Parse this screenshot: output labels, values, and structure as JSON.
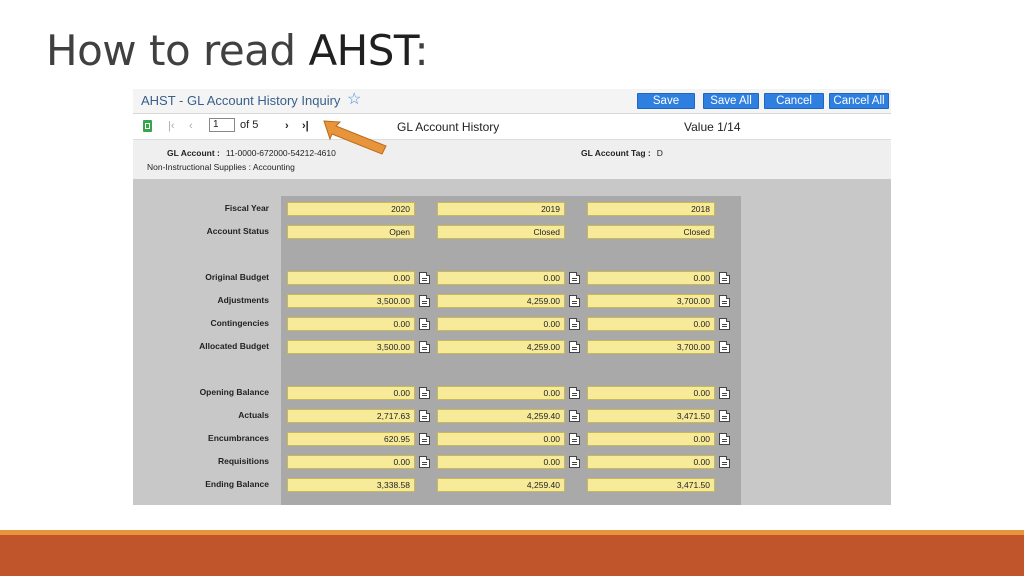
{
  "slide": {
    "title_prefix": "How to read ",
    "title_highlight": "AHST",
    "title_suffix": ":"
  },
  "app": {
    "title": "AHST - GL Account History Inquiry",
    "buttons": {
      "save": "Save",
      "save_all": "Save All",
      "cancel": "Cancel",
      "cancel_all": "Cancel All"
    }
  },
  "nav": {
    "first": "|‹",
    "prev": "‹",
    "page_value": "1",
    "of_label": "of 5",
    "next": "›",
    "last": "›|",
    "center_title": "GL Account History",
    "value_count": "Value 1/14"
  },
  "account": {
    "gl_account_label": "GL Account :",
    "gl_account_value": "11-0000-672000-54212-4610",
    "description": "Non-Instructional Supplies : Accounting",
    "tag_label": "GL Account Tag :",
    "tag_value": "D"
  },
  "history": {
    "rows": [
      {
        "label": "Fiscal Year",
        "values": [
          "2020",
          "2019",
          "2018"
        ]
      },
      {
        "label": "Account Status",
        "values": [
          "Open",
          "Closed",
          "Closed"
        ]
      },
      {
        "label": "Original Budget",
        "values": [
          "0.00",
          "0.00",
          "0.00"
        ]
      },
      {
        "label": "Adjustments",
        "values": [
          "3,500.00",
          "4,259.00",
          "3,700.00"
        ]
      },
      {
        "label": "Contingencies",
        "values": [
          "0.00",
          "0.00",
          "0.00"
        ]
      },
      {
        "label": "Allocated Budget",
        "values": [
          "3,500.00",
          "4,259.00",
          "3,700.00"
        ]
      },
      {
        "label": "Opening Balance",
        "values": [
          "0.00",
          "0.00",
          "0.00"
        ]
      },
      {
        "label": "Actuals",
        "values": [
          "2,717.63",
          "4,259.40",
          "3,471.50"
        ]
      },
      {
        "label": "Encumbrances",
        "values": [
          "620.95",
          "0.00",
          "0.00"
        ]
      },
      {
        "label": "Requisitions",
        "values": [
          "0.00",
          "0.00",
          "0.00"
        ]
      },
      {
        "label": "Ending Balance",
        "values": [
          "3,338.58",
          "4,259.40",
          "3,471.50"
        ]
      }
    ]
  },
  "colors": {
    "accent_orange": "#e8943a",
    "footer": "#c0552b",
    "button_blue": "#2f7fe0",
    "field_yellow": "#f7eb9a"
  }
}
